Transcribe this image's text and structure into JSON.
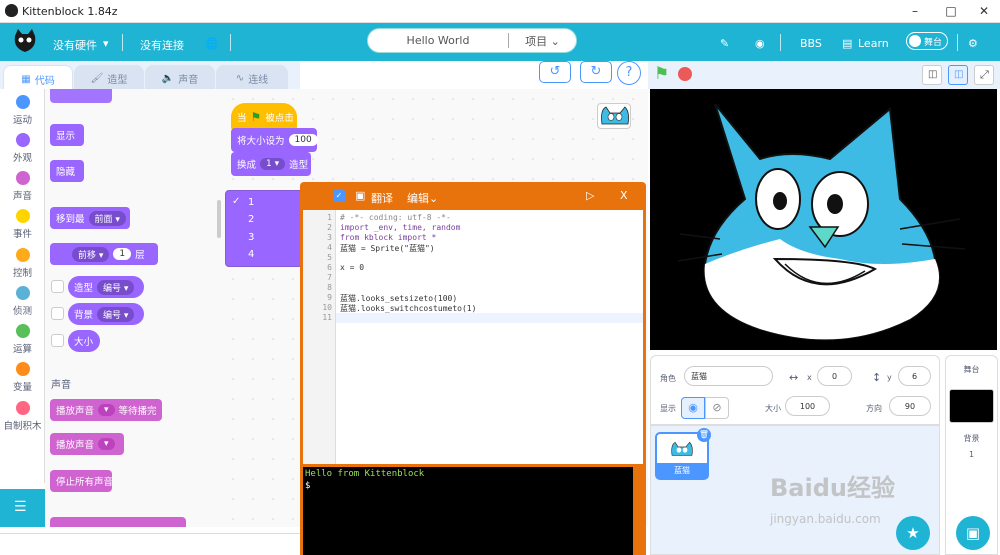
{
  "window": {
    "title": "Kittenblock 1.84z"
  },
  "menubar": {
    "hardware": "没有硬件",
    "connection": "没有连接",
    "project_title": "Hello World",
    "project_menu": "项目",
    "bbs": "BBS",
    "learn": "Learn",
    "stage_toggle": "舞台"
  },
  "tabs": [
    {
      "label": "代码"
    },
    {
      "label": "造型"
    },
    {
      "label": "声音"
    },
    {
      "label": "连线"
    }
  ],
  "categories": [
    {
      "label": "运动",
      "color": "#4c97ff"
    },
    {
      "label": "外观",
      "color": "#9966ff"
    },
    {
      "label": "声音",
      "color": "#cf63cf"
    },
    {
      "label": "事件",
      "color": "#ffd500"
    },
    {
      "label": "控制",
      "color": "#ffab19"
    },
    {
      "label": "侦测",
      "color": "#5cb1d6"
    },
    {
      "label": "运算",
      "color": "#59c059"
    },
    {
      "label": "变量",
      "color": "#ff8c1a"
    },
    {
      "label": "自制积木",
      "color": "#ff6680"
    }
  ],
  "palette": {
    "show": "显示",
    "hide": "隐藏",
    "goto_layer": "移到最",
    "goto_layer_val": "前面",
    "move_layer_val": "前移",
    "move_layer_num": "1",
    "move_layer_unit": "层",
    "costume": "造型",
    "costume_val": "编号",
    "backdrop": "背景",
    "backdrop_val": "编号",
    "size": "大小",
    "sound_section": "声音",
    "play_until": "播放声音",
    "play_until_suffix": "等待播完",
    "start_sound": "播放声音",
    "stop_all": "停止所有声音"
  },
  "script": {
    "when_flag": "当",
    "when_flag_suffix": "被点击",
    "set_size": "将大小设为",
    "set_size_val": "100",
    "switch_costume": "换成",
    "switch_costume_val": "1",
    "switch_costume_suffix": "造型"
  },
  "dropdown": {
    "items": [
      "1",
      "2",
      "3",
      "4"
    ],
    "selected": "1"
  },
  "editor": {
    "translate": "翻译",
    "edit": "编辑",
    "close": "X",
    "lines": [
      "# -*- coding: utf-8 -*-",
      "import _env, time, random",
      "from kblock import *",
      "蓝猫 = Sprite(\"蓝猫\")",
      "",
      "x = 0",
      "",
      "",
      "蓝猫.looks_setsizeto(100)",
      "蓝猫.looks_switchcostumeto(1)",
      ""
    ],
    "line_numbers": [
      "1",
      "2",
      "3",
      "4",
      "5",
      "6",
      "7",
      "8",
      "9",
      "10",
      "11"
    ],
    "console_line1": "Hello from Kittenblock",
    "console_line2": "$"
  },
  "sprite_info": {
    "sprite_label": "角色",
    "sprite_name": "蓝猫",
    "x_label": "x",
    "x_val": "0",
    "y_label": "y",
    "y_val": "6",
    "show_label": "显示",
    "size_label": "大小",
    "size_val": "100",
    "direction_label": "方向",
    "direction_val": "90"
  },
  "sprites": [
    {
      "name": "蓝猫"
    }
  ],
  "stage_panel": {
    "title": "舞台",
    "backdrop_label": "背景",
    "backdrop_count": "1"
  },
  "watermark": {
    "line1": "Baidu经验",
    "line2": "jingyan.baidu.com"
  }
}
